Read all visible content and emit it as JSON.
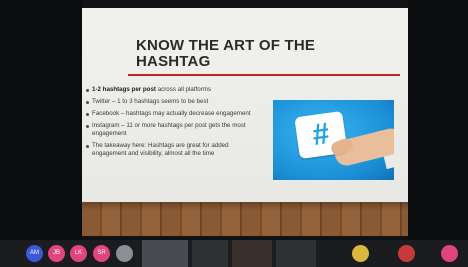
{
  "slide": {
    "title_line1": "KNOW THE ART OF THE",
    "title_line2": "HASHTAG",
    "bullets": [
      {
        "strong": "1-2 hashtags per post",
        "text": " across all platforms"
      },
      {
        "strong": "",
        "text": "Twitter – 1 to 3 hashtags seems to be best"
      },
      {
        "strong": "",
        "text": "Facebook – hashtags may actually decrease engagement"
      },
      {
        "strong": "",
        "text": "Instagram – 11 or more hashtags per post gets the most engagement"
      },
      {
        "strong": "",
        "text": "The takeaway here: Hashtags are great for added engagement and visibility, almost all the time"
      }
    ],
    "photo_symbol": "#"
  },
  "colors": {
    "title_rule": "#c8202a",
    "photo_bg": "#1a8ed6"
  },
  "taskbar": {
    "participants": [
      {
        "initials": "AM",
        "color": "#3d57d8",
        "icon": "participant-avatar"
      },
      {
        "initials": "JB",
        "color": "#e0457b",
        "icon": "participant-avatar"
      },
      {
        "initials": "LK",
        "color": "#e0457b",
        "icon": "participant-avatar"
      },
      {
        "initials": "SR",
        "color": "#e0457b",
        "icon": "participant-avatar"
      },
      {
        "initials": "",
        "color": "#8c8f96",
        "icon": "participant-photo"
      },
      {
        "initials": "",
        "color": "#4a4b50",
        "icon": "participant-video"
      },
      {
        "initials": "",
        "color": "#2f3034",
        "icon": "participant-video"
      },
      {
        "initials": "",
        "color": "#3b2f2c",
        "icon": "participant-video"
      },
      {
        "initials": "",
        "color": "#2f3034",
        "icon": "participant-video"
      },
      {
        "initials": "",
        "color": "#d9b93c",
        "icon": "participant-avatar"
      },
      {
        "initials": "",
        "color": "#c63a3a",
        "icon": "participant-avatar"
      },
      {
        "initials": "",
        "color": "#e0457b",
        "icon": "participant-avatar"
      }
    ]
  }
}
